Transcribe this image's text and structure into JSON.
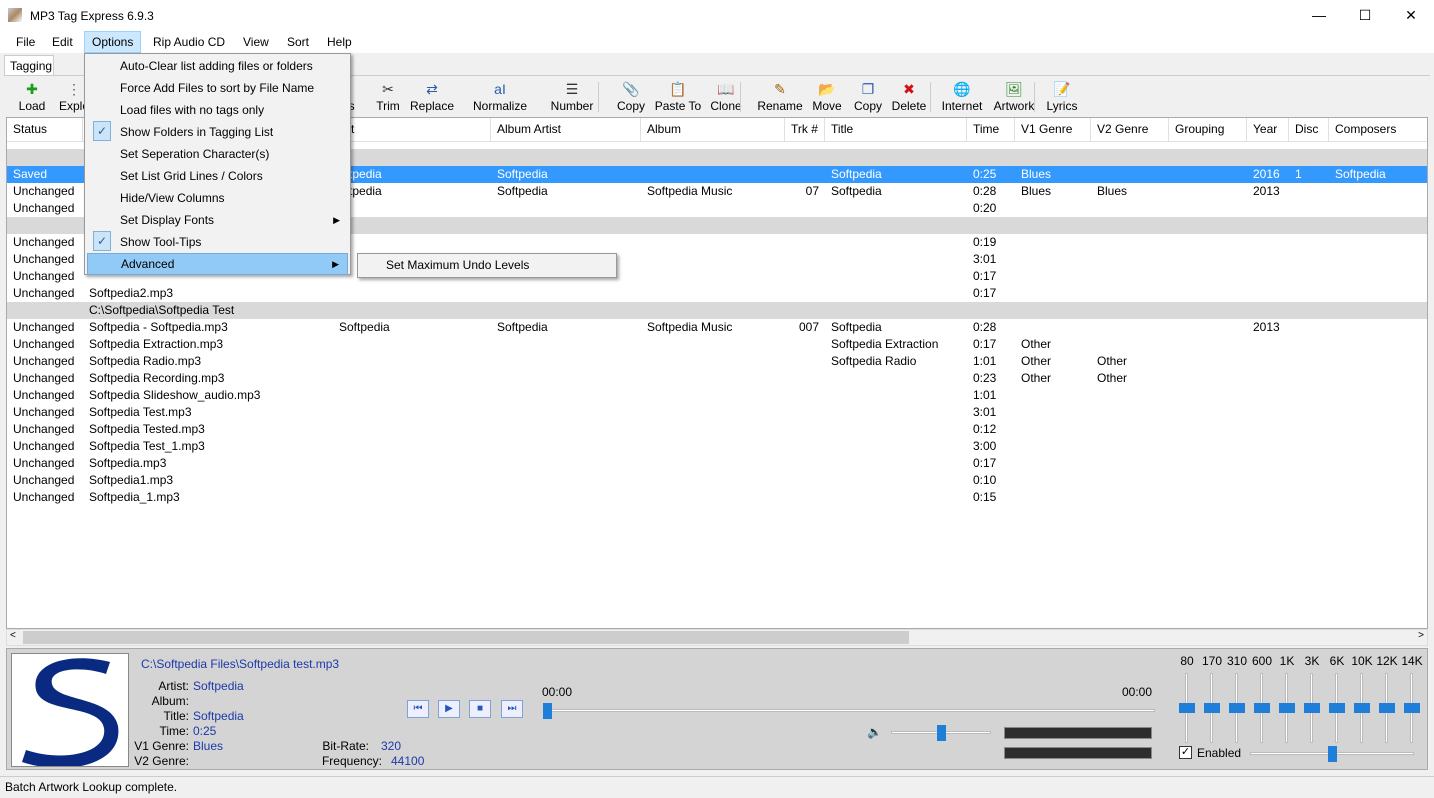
{
  "window": {
    "title": "MP3 Tag Express 6.9.3",
    "minimize": "—",
    "maximize": "☐",
    "close": "✕"
  },
  "menubar": [
    "File",
    "Edit",
    "Options",
    "Rip Audio CD",
    "View",
    "Sort",
    "Help"
  ],
  "tab": "Tagging",
  "toolbar": [
    {
      "label": "Load",
      "icon": "plus-icon",
      "glyph": "✚",
      "color": "#1a9a1a"
    },
    {
      "label": "Explo",
      "icon": "tree-icon",
      "glyph": "⋮",
      "color": "#555"
    },
    {
      "label": "ags",
      "icon": "tags-icon",
      "glyph": "",
      "color": "#555"
    },
    {
      "label": "Trim",
      "icon": "scissors-icon",
      "glyph": "✂",
      "color": "#333"
    },
    {
      "label": "Replace",
      "icon": "replace-icon",
      "glyph": "⇄",
      "color": "#2a5db0"
    },
    {
      "label": "Normalize",
      "icon": "text-case-icon",
      "glyph": "aI",
      "color": "#2a5db0"
    },
    {
      "label": "Number",
      "icon": "numbered-list-icon",
      "glyph": "☰",
      "color": "#333"
    },
    {
      "label": "Copy",
      "icon": "paperclip-icon",
      "glyph": "📎",
      "color": "#555"
    },
    {
      "label": "Paste To",
      "icon": "clipboard-icon",
      "glyph": "📋",
      "color": "#333"
    },
    {
      "label": "Clone",
      "icon": "book-icon",
      "glyph": "📖",
      "color": "#333"
    },
    {
      "label": "Rename",
      "icon": "pencil-icon",
      "glyph": "✎",
      "color": "#a06000"
    },
    {
      "label": "Move",
      "icon": "move-icon",
      "glyph": "📂",
      "color": "#c08000"
    },
    {
      "label": "Copy",
      "icon": "copy-files-icon",
      "glyph": "❐",
      "color": "#2a5db0"
    },
    {
      "label": "Delete",
      "icon": "delete-icon",
      "glyph": "✖",
      "color": "#d01010"
    },
    {
      "label": "Internet",
      "icon": "globe-icon",
      "glyph": "🌐",
      "color": "#2a5db0"
    },
    {
      "label": "Artwork",
      "icon": "picture-icon",
      "glyph": "🖼",
      "color": "#2a8a2a"
    },
    {
      "label": "Lyrics",
      "icon": "note-icon",
      "glyph": "📝",
      "color": "#d0b000"
    }
  ],
  "columns": [
    "Status",
    "",
    "tist",
    "Album Artist",
    "Album",
    "Trk #",
    "Title",
    "Time",
    "V1 Genre",
    "V2 Genre",
    "Grouping",
    "Year",
    "Disc",
    "Composers"
  ],
  "rows": [
    {
      "type": "group",
      "path": ""
    },
    {
      "type": "file",
      "selected": true,
      "status": "Saved",
      "file": "",
      "artist": "oftpedia",
      "album_artist": "Softpedia",
      "album": "",
      "trk": "",
      "title": "Softpedia",
      "time": "0:25",
      "v1": "Blues",
      "v2": "",
      "year": "2016",
      "disc": "1",
      "composer": "Softpedia"
    },
    {
      "type": "file",
      "status": "Unchanged",
      "file": "",
      "artist": "oftpedia",
      "album_artist": "Softpedia",
      "album": "Softpedia Music",
      "trk": "07",
      "title": "Softpedia",
      "time": "0:28",
      "v1": "Blues",
      "v2": "Blues",
      "year": "2013",
      "disc": "",
      "composer": ""
    },
    {
      "type": "file",
      "status": "Unchanged",
      "file": "",
      "artist": "",
      "album_artist": "",
      "album": "",
      "trk": "",
      "title": "",
      "time": "0:20",
      "v1": "",
      "v2": "",
      "year": "",
      "disc": "",
      "composer": ""
    },
    {
      "type": "group",
      "path": ""
    },
    {
      "type": "file",
      "status": "Unchanged",
      "file": "",
      "artist": "",
      "album_artist": "",
      "album": "",
      "trk": "",
      "title": "",
      "time": "0:19",
      "v1": "",
      "v2": "",
      "year": "",
      "disc": "",
      "composer": ""
    },
    {
      "type": "file",
      "status": "Unchanged",
      "file": "",
      "artist": "",
      "album_artist": "",
      "album": "",
      "trk": "",
      "title": "",
      "time": "3:01",
      "v1": "",
      "v2": "",
      "year": "",
      "disc": "",
      "composer": ""
    },
    {
      "type": "file",
      "status": "Unchanged",
      "file": "",
      "artist": "",
      "album_artist": "",
      "album": "",
      "trk": "",
      "title": "",
      "time": "0:17",
      "v1": "",
      "v2": "",
      "year": "",
      "disc": "",
      "composer": ""
    },
    {
      "type": "file",
      "status": "Unchanged",
      "file": "Softpedia2.mp3",
      "artist": "",
      "album_artist": "",
      "album": "",
      "trk": "",
      "title": "",
      "time": "0:17",
      "v1": "",
      "v2": "",
      "year": "",
      "disc": "",
      "composer": ""
    },
    {
      "type": "group",
      "path": "C:\\Softpedia\\Softpedia Test"
    },
    {
      "type": "file",
      "status": "Unchanged",
      "file": "Softpedia - Softpedia.mp3",
      "artist": "Softpedia",
      "album_artist": "Softpedia",
      "album": "Softpedia Music",
      "trk": "007",
      "title": "Softpedia",
      "time": "0:28",
      "v1": "",
      "v2": "",
      "year": "2013",
      "disc": "",
      "composer": ""
    },
    {
      "type": "file",
      "status": "Unchanged",
      "file": "Softpedia Extraction.mp3",
      "artist": "",
      "album_artist": "",
      "album": "",
      "trk": "",
      "title": "Softpedia Extraction",
      "time": "0:17",
      "v1": "Other",
      "v2": "",
      "year": "",
      "disc": "",
      "composer": ""
    },
    {
      "type": "file",
      "status": "Unchanged",
      "file": "Softpedia Radio.mp3",
      "artist": "",
      "album_artist": "",
      "album": "",
      "trk": "",
      "title": "Softpedia Radio",
      "time": "1:01",
      "v1": "Other",
      "v2": "Other",
      "year": "",
      "disc": "",
      "composer": ""
    },
    {
      "type": "file",
      "status": "Unchanged",
      "file": "Softpedia Recording.mp3",
      "artist": "",
      "album_artist": "",
      "album": "",
      "trk": "",
      "title": "",
      "time": "0:23",
      "v1": "Other",
      "v2": "Other",
      "year": "",
      "disc": "",
      "composer": ""
    },
    {
      "type": "file",
      "status": "Unchanged",
      "file": "Softpedia Slideshow_audio.mp3",
      "artist": "",
      "album_artist": "",
      "album": "",
      "trk": "",
      "title": "",
      "time": "1:01",
      "v1": "",
      "v2": "",
      "year": "",
      "disc": "",
      "composer": ""
    },
    {
      "type": "file",
      "status": "Unchanged",
      "file": "Softpedia Test.mp3",
      "artist": "",
      "album_artist": "",
      "album": "",
      "trk": "",
      "title": "",
      "time": "3:01",
      "v1": "",
      "v2": "",
      "year": "",
      "disc": "",
      "composer": ""
    },
    {
      "type": "file",
      "status": "Unchanged",
      "file": "Softpedia Tested.mp3",
      "artist": "",
      "album_artist": "",
      "album": "",
      "trk": "",
      "title": "",
      "time": "0:12",
      "v1": "",
      "v2": "",
      "year": "",
      "disc": "",
      "composer": ""
    },
    {
      "type": "file",
      "status": "Unchanged",
      "file": "Softpedia Test_1.mp3",
      "artist": "",
      "album_artist": "",
      "album": "",
      "trk": "",
      "title": "",
      "time": "3:00",
      "v1": "",
      "v2": "",
      "year": "",
      "disc": "",
      "composer": ""
    },
    {
      "type": "file",
      "status": "Unchanged",
      "file": "Softpedia.mp3",
      "artist": "",
      "album_artist": "",
      "album": "",
      "trk": "",
      "title": "",
      "time": "0:17",
      "v1": "",
      "v2": "",
      "year": "",
      "disc": "",
      "composer": ""
    },
    {
      "type": "file",
      "status": "Unchanged",
      "file": "Softpedia1.mp3",
      "artist": "",
      "album_artist": "",
      "album": "",
      "trk": "",
      "title": "",
      "time": "0:10",
      "v1": "",
      "v2": "",
      "year": "",
      "disc": "",
      "composer": ""
    },
    {
      "type": "file",
      "status": "Unchanged",
      "file": "Softpedia_1.mp3",
      "artist": "",
      "album_artist": "",
      "album": "",
      "trk": "",
      "title": "",
      "time": "0:15",
      "v1": "",
      "v2": "",
      "year": "",
      "disc": "",
      "composer": ""
    }
  ],
  "options_menu": [
    {
      "label": "Auto-Clear list adding files or folders",
      "checked": false,
      "submenu": false,
      "highlighted": false
    },
    {
      "label": "Force Add Files to sort by File Name",
      "checked": false,
      "submenu": false,
      "highlighted": false
    },
    {
      "label": "Load files with no tags only",
      "checked": false,
      "submenu": false,
      "highlighted": false
    },
    {
      "label": "Show Folders in Tagging List",
      "checked": true,
      "submenu": false,
      "highlighted": false
    },
    {
      "label": "Set Seperation Character(s)",
      "checked": false,
      "submenu": false,
      "highlighted": false
    },
    {
      "label": "Set List Grid Lines / Colors",
      "checked": false,
      "submenu": false,
      "highlighted": false
    },
    {
      "label": "Hide/View Columns",
      "checked": false,
      "submenu": false,
      "highlighted": false
    },
    {
      "label": "Set Display Fonts",
      "checked": false,
      "submenu": true,
      "highlighted": false
    },
    {
      "label": "Show Tool-Tips",
      "checked": true,
      "submenu": false,
      "highlighted": false
    },
    {
      "label": "Advanced",
      "checked": false,
      "submenu": true,
      "highlighted": true
    }
  ],
  "advanced_submenu": [
    "Set Maximum Undo Levels"
  ],
  "player": {
    "path": "C:\\Softpedia Files\\Softpedia test.mp3",
    "labels": {
      "artist": "Artist:",
      "album": "Album:",
      "title": "Title:",
      "time": "Time:",
      "v1": "V1 Genre:",
      "v2": "V2 Genre:",
      "bitrate": "Bit-Rate:",
      "frequency": "Frequency:"
    },
    "values": {
      "artist": "Softpedia",
      "album": "",
      "title": "Softpedia",
      "time": "0:25",
      "v1": "Blues",
      "v2": "",
      "bitrate": "320",
      "frequency": "44100"
    },
    "elapsed": "00:00",
    "remaining": "00:00",
    "progress": 0,
    "volume": 0.5
  },
  "equalizer": {
    "bands": [
      "80",
      "170",
      "310",
      "600",
      "1K",
      "3K",
      "6K",
      "10K",
      "12K",
      "14K"
    ],
    "levels": [
      0.5,
      0.5,
      0.5,
      0.5,
      0.5,
      0.5,
      0.5,
      0.5,
      0.5,
      0.5
    ],
    "enabled_label": "Enabled",
    "enabled": true,
    "preamp": 0.5
  },
  "status_text": "Batch Artwork Lookup complete.",
  "colors": {
    "selection": "#3399ff",
    "link": "#1c3aa8",
    "accent": "#1f7fd8"
  }
}
